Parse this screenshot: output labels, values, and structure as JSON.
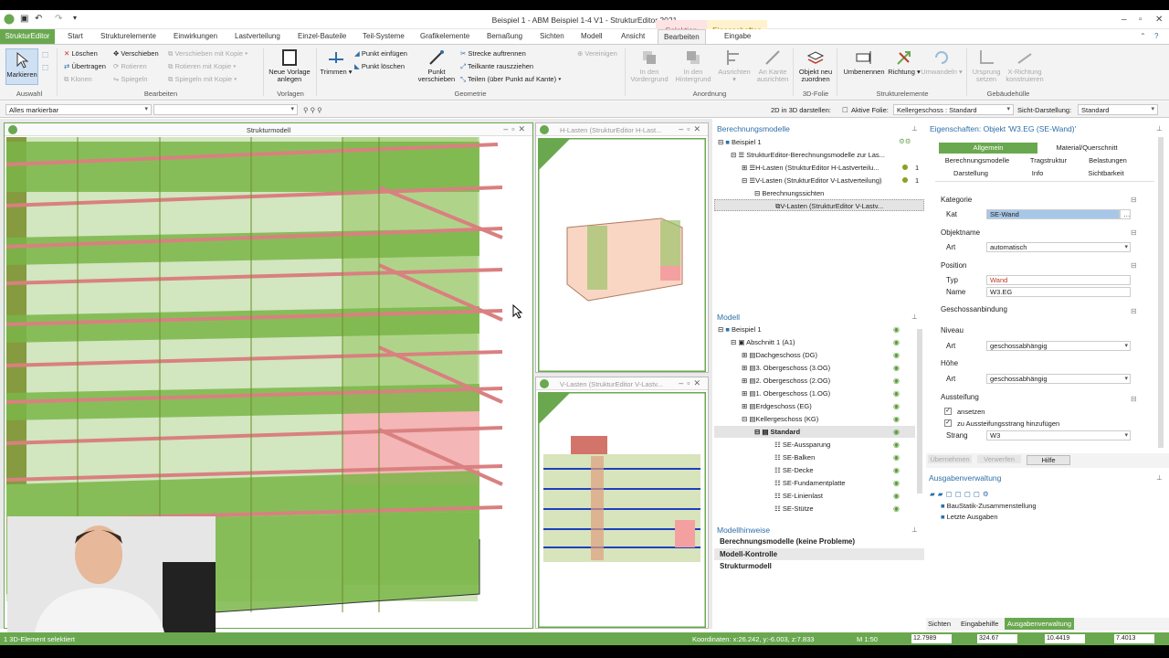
{
  "titlebar": {
    "title": "Beispiel 1 - ABM Beispiel 1-4 V1 - StrukturEditor 2021",
    "ctx_selection": "Selektion",
    "ctx_properties": "Eigenschaften"
  },
  "tabs": {
    "app": "StrukturEditor",
    "items": [
      "Start",
      "Strukturelemente",
      "Einwirkungen",
      "Lastverteilung",
      "Einzel-Bauteile",
      "Teil-Systeme",
      "Grafikelemente",
      "Bemaßung",
      "Sichten",
      "Modell",
      "Ansicht",
      "Bearbeiten",
      "Eingabe"
    ]
  },
  "ribbon": {
    "markieren": "Markieren",
    "g_auswahl": "Auswahl",
    "loeschen": "Löschen",
    "uebertragen": "Übertragen",
    "klonen": "Klonen",
    "verschieben": "Verschieben",
    "rotieren": "Rotieren",
    "spiegeln": "Spiegeln",
    "vk": "Verschieben mit Kopie",
    "rk": "Rotieren mit Kopie",
    "sk": "Spiegeln mit Kopie",
    "g_bearbeiten": "Bearbeiten",
    "neue_vorlage": "Neue Vorlage anlegen",
    "g_vorlagen": "Vorlagen",
    "trimmen": "Trimmen",
    "punkt_einfuegen": "Punkt einfügen",
    "punkt_loeschen": "Punkt löschen",
    "punkt_verschieben": "Punkt verschieben",
    "strecke": "Strecke auftrennen",
    "teilkante": "Teilkante rauszziehen",
    "teilen": "Teilen (über Punkt auf Kante)",
    "vereinigen": "Vereinigen",
    "g_geometrie": "Geometrie",
    "vordergrund": "In den Vordergrund",
    "hintergrund": "In den Hintergrund",
    "ausrichten": "Ausrichten",
    "an_kante": "An Kante ausrichten",
    "g_anordnung": "Anordnung",
    "objekt_neu": "Objekt neu zuordnen",
    "g_3dfolie": "3D-Folie",
    "umbenennen": "Umbenennen",
    "richtung": "Richtung",
    "umwandeln": "Umwandeln",
    "g_strukturelemente": "Strukturelemente",
    "ursprung": "Ursprung setzen",
    "xrichtung": "X-Richtung konstruieren",
    "g_gebaeudehuelle": "Gebäudehülle"
  },
  "optbar": {
    "filter": "Alles markierbar",
    "label_3d": "2D in 3D darstellen:",
    "label_folie": "Aktive Folie:",
    "folie": "Kellergeschoss : Standard",
    "label_sicht": "Sicht-Darstellung:",
    "sicht": "Standard"
  },
  "panels": {
    "struktur": "Strukturmodell",
    "hlasten": "H-Lasten (StrukturEditor H-Last...",
    "vlasten": "V-Lasten (StrukturEditor V-Lastv..."
  },
  "berechnungsmodelle": {
    "header": "Berechnungsmodelle",
    "items": [
      {
        "label": "Beispiel 1"
      },
      {
        "label": "StrukturEditor-Berechnungsmodelle zur Las..."
      },
      {
        "label": "H-Lasten (StrukturEditor H-Lastverteilu...",
        "count": "1"
      },
      {
        "label": "V-Lasten (StrukturEditor V-Lastverteilung)",
        "count": "1"
      },
      {
        "label": "Berechnungssichten"
      },
      {
        "label": "V-Lasten (StrukturEditor V-Lastv..."
      }
    ]
  },
  "modell": {
    "header": "Modell",
    "items": [
      {
        "label": "Beispiel 1"
      },
      {
        "label": "Abschnitt 1 (A1)"
      },
      {
        "label": "Dachgeschoss (DG)"
      },
      {
        "label": "3. Obergeschoss (3.OG)"
      },
      {
        "label": "2. Obergeschoss (2.OG)"
      },
      {
        "label": "1. Obergeschoss (1.OG)"
      },
      {
        "label": "Erdgeschoss (EG)"
      },
      {
        "label": "Kellergeschoss (KG)"
      },
      {
        "label": "Standard"
      },
      {
        "label": "SE-Aussparung"
      },
      {
        "label": "SE-Balken"
      },
      {
        "label": "SE-Decke"
      },
      {
        "label": "SE-Fundamentplatte"
      },
      {
        "label": "SE-Linienlast"
      },
      {
        "label": "SE-Stütze"
      }
    ]
  },
  "hinweise": {
    "header": "Modellhinweise",
    "items": [
      "Berechnungsmodelle (keine Probleme)",
      "Modell-Kontrolle",
      "Strukturmodell"
    ]
  },
  "props": {
    "header": "Eigenschaften: Objekt 'W3.EG (SE-Wand)'",
    "tabs": [
      "Allgemein",
      "Material/Querschnitt",
      "Berechnungsmodelle",
      "Tragstruktur",
      "Belastungen",
      "Darstellung",
      "Info",
      "Sichtbarkeit"
    ],
    "kategorie": "Kategorie",
    "kat_label": "Kat",
    "kat_value": "SE-Wand",
    "objektname": "Objektname",
    "art_label": "Art",
    "art_value": "automatisch",
    "position": "Position",
    "typ_label": "Typ",
    "typ_value": "Wand",
    "name_label": "Name",
    "name_value": "W3.EG",
    "geschoss": "Geschossanbindung",
    "niveau": "Niveau",
    "niveau_art": "geschossabhängig",
    "hoehe": "Höhe",
    "hoehe_art": "geschossabhängig",
    "aussteifung": "Aussteifung",
    "ansetzen": "ansetzen",
    "zu_strang": "zu Aussteifungsstrang hinzufügen",
    "strang_label": "Strang",
    "strang_value": "W3",
    "btn_uebernehmen": "Übernehmen",
    "btn_verwerfen": "Verwerfen",
    "btn_hilfe": "Hilfe"
  },
  "ausgaben": {
    "header": "Ausgabenverwaltung",
    "items": [
      "BauStatik-Zusammenstellung",
      "Letzte Ausgaben"
    ],
    "tabs": [
      "Sichten",
      "Eingabehilfe",
      "Ausgabenverwaltung"
    ]
  },
  "status": {
    "left": "1 3D-Element selektiert",
    "coords": "Koordinaten: x:26.242, y:-6.003, z:7.833",
    "scale": "M 1:50",
    "v1": "12.7989",
    "v2": "324.67",
    "v3": "10.4419",
    "v4": "7.4013"
  },
  "colors": {
    "green": "#6aa84f",
    "ribbon": "#f3f3f3",
    "accent": "#2f6fa8"
  }
}
